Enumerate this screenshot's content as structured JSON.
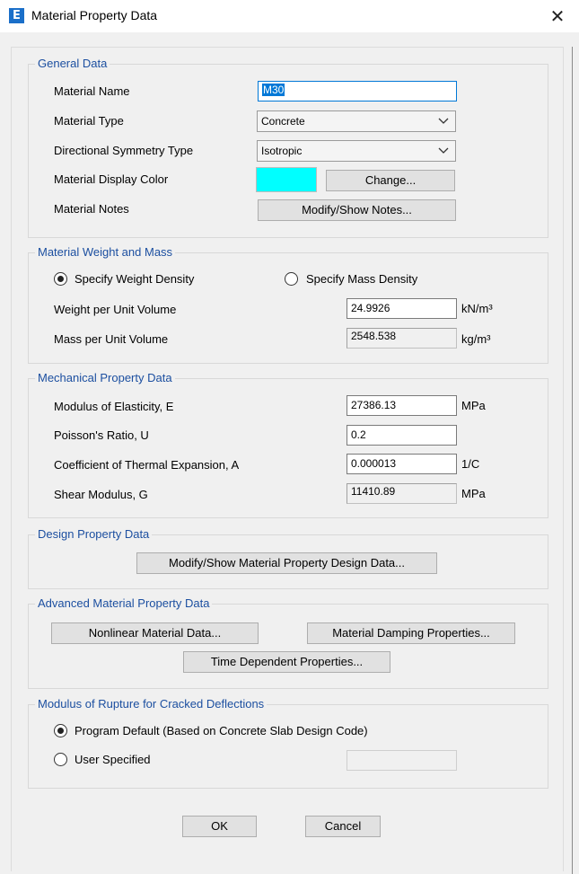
{
  "window": {
    "title": "Material Property Data",
    "app_icon_letter": "E"
  },
  "general": {
    "title": "General Data",
    "material_name_label": "Material Name",
    "material_name_value": "M30",
    "material_type_label": "Material Type",
    "material_type_value": "Concrete",
    "symmetry_label": "Directional Symmetry Type",
    "symmetry_value": "Isotropic",
    "display_color_label": "Material Display Color",
    "display_color": "#00ffff",
    "change_button": "Change...",
    "notes_label": "Material Notes",
    "notes_button": "Modify/Show Notes..."
  },
  "weight": {
    "title": "Material Weight and Mass",
    "weight_density_option": "Specify Weight Density",
    "mass_density_option": "Specify Mass Density",
    "selected": "weight",
    "weight_label": "Weight per Unit Volume",
    "weight_value": "24.9926",
    "weight_unit": "kN/m³",
    "mass_label": "Mass per Unit Volume",
    "mass_value": "2548.538",
    "mass_unit": "kg/m³"
  },
  "mechanical": {
    "title": "Mechanical Property Data",
    "modulus_label": "Modulus of Elasticity,  E",
    "modulus_value": "27386.13",
    "modulus_unit": "MPa",
    "poisson_label": "Poisson's Ratio,  U",
    "poisson_value": "0.2",
    "thermal_label": "Coefficient of Thermal Expansion,  A",
    "thermal_value": "0.000013",
    "thermal_unit": "1/C",
    "shear_label": "Shear Modulus,  G",
    "shear_value": "11410.89",
    "shear_unit": "MPa"
  },
  "design": {
    "title": "Design Property Data",
    "button": "Modify/Show Material Property Design Data..."
  },
  "advanced": {
    "title": "Advanced Material Property Data",
    "nonlinear_button": "Nonlinear Material Data...",
    "damping_button": "Material Damping Properties...",
    "time_button": "Time Dependent Properties..."
  },
  "rupture": {
    "title": "Modulus of Rupture for Cracked Deflections",
    "program_default_option": "Program Default  (Based on Concrete Slab Design Code)",
    "user_specified_option": "User Specified",
    "selected": "program_default",
    "user_value": ""
  },
  "footer": {
    "ok_button": "OK",
    "cancel_button": "Cancel"
  },
  "colors": {
    "group_title": "#1c4fa0",
    "focus_border": "#0078d7",
    "dialog_bg": "#f0f0f0"
  }
}
